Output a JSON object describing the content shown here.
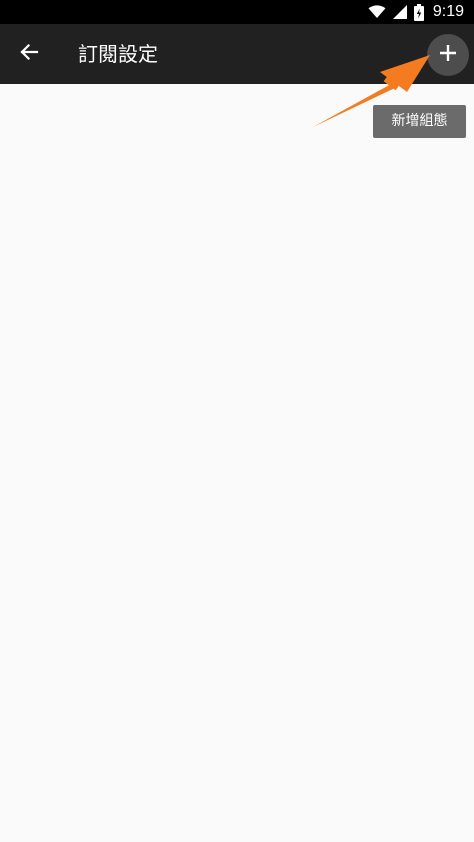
{
  "status_bar": {
    "time": "9:19",
    "icons": [
      "wifi-icon",
      "cell-signal-icon",
      "battery-icon"
    ]
  },
  "app_bar": {
    "back_icon": "arrow-left-icon",
    "title": "訂閱設定",
    "add_icon": "plus-icon"
  },
  "tooltip": {
    "label": "新增組態"
  },
  "colors": {
    "status_bar": "#000000",
    "app_bar": "#212121",
    "add_button": "#4d4d4d",
    "tooltip": "#6b6b6b",
    "background": "#fafafa",
    "annotation_arrow": "#f47b20"
  }
}
